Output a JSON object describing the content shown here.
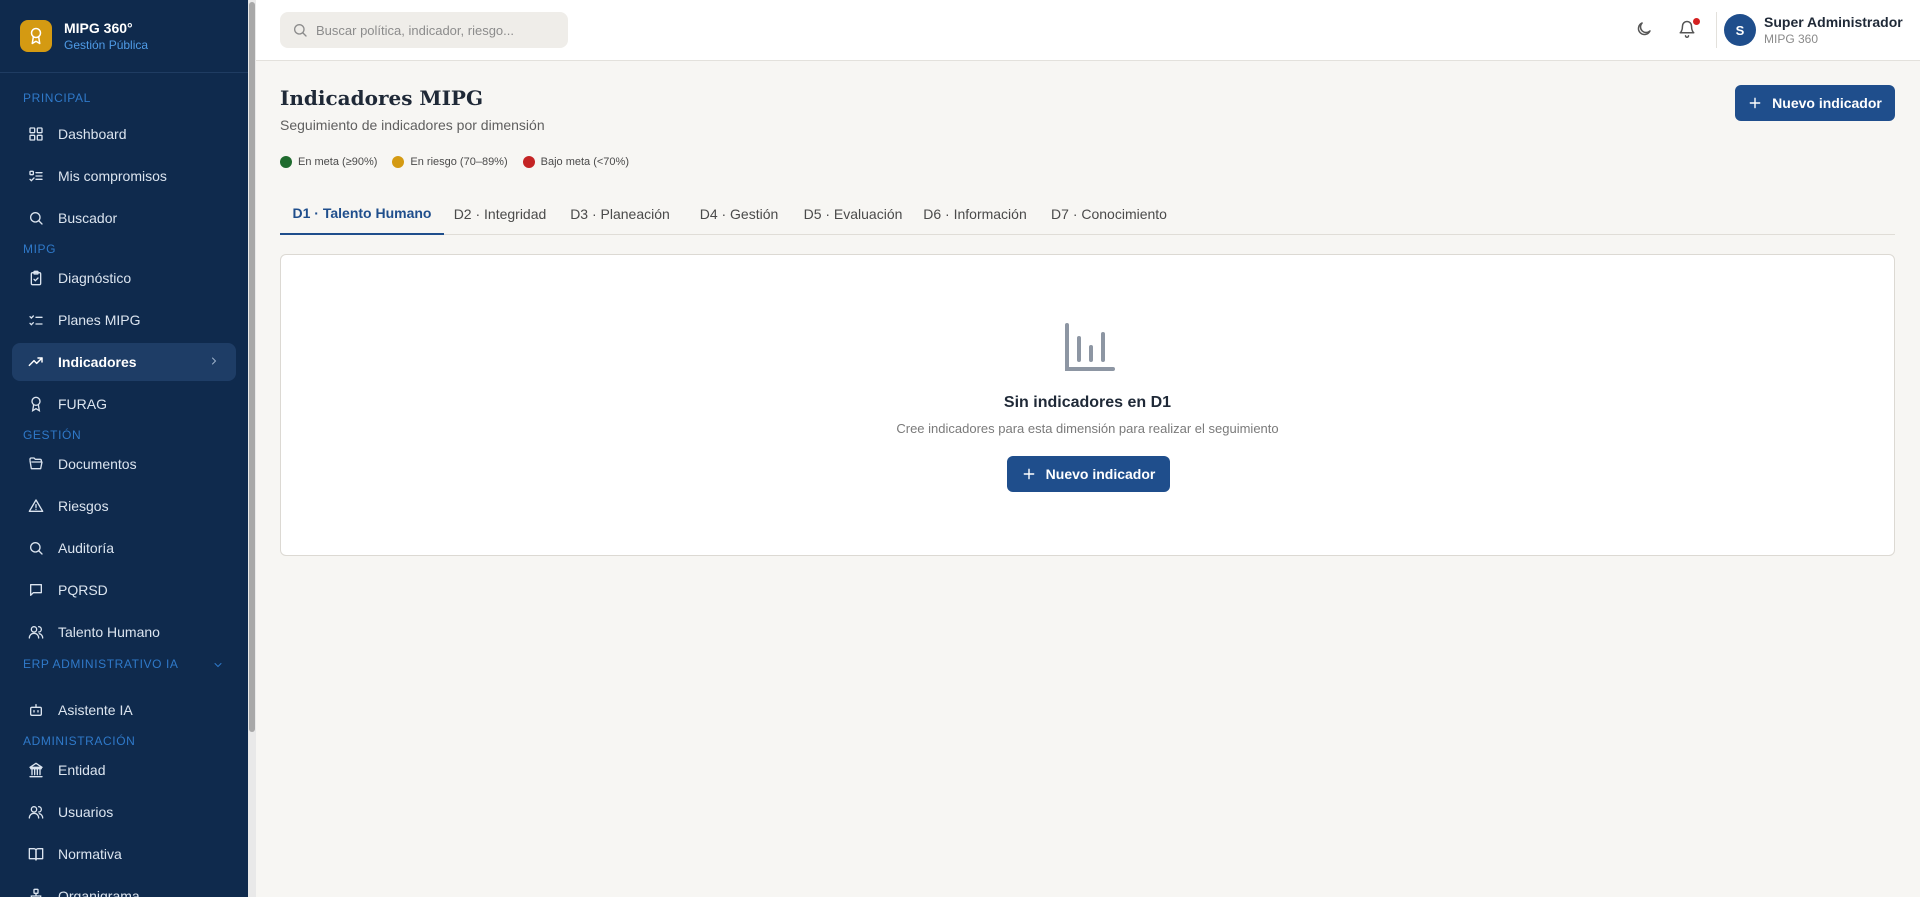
{
  "brand": {
    "title": "MIPG 360°",
    "subtitle": "Gestión Pública",
    "logo_icon": "award-icon",
    "accent": "#d49a12"
  },
  "sidebar": {
    "sections": {
      "principal": "PRINCIPAL",
      "mipg": "MIPG",
      "gestion": "GESTIÓN",
      "erp": "ERP ADMINISTRATIVO IA",
      "admin": "ADMINISTRACIÓN"
    },
    "items": {
      "dashboard": "Dashboard",
      "compromisos": "Mis compromisos",
      "buscador": "Buscador",
      "diagnostico": "Diagnóstico",
      "planes": "Planes MIPG",
      "indicadores": "Indicadores",
      "furag": "FURAG",
      "documentos": "Documentos",
      "riesgos": "Riesgos",
      "auditoria": "Auditoría",
      "pqrsd": "PQRSD",
      "talento": "Talento Humano",
      "asistente": "Asistente IA",
      "entidad": "Entidad",
      "usuarios": "Usuarios",
      "normativa": "Normativa",
      "organigrama": "Organigrama"
    },
    "active_item": "Indicadores",
    "background": "#0f2a4d"
  },
  "header": {
    "search_placeholder": "Buscar política, indicador, riesgo...",
    "user": {
      "initial": "S",
      "name": "Super Administrador",
      "org": "MIPG 360"
    }
  },
  "page": {
    "title": "Indicadores MIPG",
    "subtitle": "Seguimiento de indicadores por dimensión",
    "new_button": "Nuevo indicador"
  },
  "legend": [
    {
      "label": "En meta (≥90%)",
      "color": "#1f6b2e"
    },
    {
      "label": "En riesgo (70–89%)",
      "color": "#d49a12"
    },
    {
      "label": "Bajo meta (<70%)",
      "color": "#c42424"
    }
  ],
  "tabs": [
    "D1 · Talento Humano",
    "D2 · Integridad",
    "D3 · Planeación",
    "D4 · Gestión",
    "D5 · Evaluación",
    "D6 · Información",
    "D7 · Conocimiento"
  ],
  "active_tab": "D1 · Talento Humano",
  "empty_state": {
    "icon": "bar-chart-icon",
    "title": "Sin indicadores en D1",
    "description": "Cree indicadores para esta dimensión para realizar el seguimiento",
    "button": "Nuevo indicador"
  },
  "primary_color": "#1f4e8c"
}
